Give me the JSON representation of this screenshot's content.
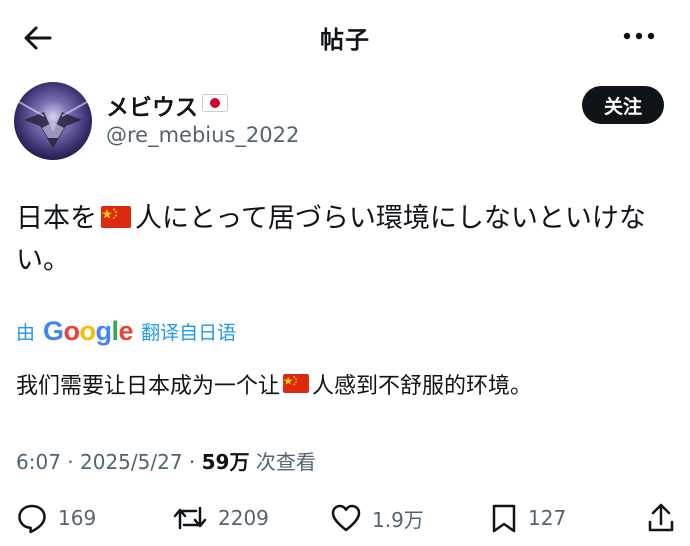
{
  "header": {
    "title": "帖子"
  },
  "author": {
    "name": "メビウス",
    "handle": "@re_mebius_2022",
    "follow_label": "关注"
  },
  "post": {
    "text_part1": "日本を",
    "text_part2": "人にとって居づらい環境にしないといけない。",
    "translate_prefix": "由",
    "translate_brand": "Google",
    "translate_suffix": "翻译自日语",
    "translated_part1": "我们需要让日本成为一个让",
    "translated_part2": "人感到不舒服的环境。"
  },
  "meta": {
    "time": "6:07",
    "sep1": " · ",
    "date": "2025/5/27",
    "sep2": " · ",
    "views": "59万",
    "views_label": " 次查看"
  },
  "actions": {
    "replies": "169",
    "reposts": "2209",
    "likes": "1.9万",
    "bookmarks": "127"
  },
  "icons": {
    "back": "arrow-left-icon",
    "more": "more-horizontal-icon",
    "reply": "reply-icon",
    "repost": "repost-icon",
    "like": "heart-icon",
    "bookmark": "bookmark-icon",
    "share": "share-icon"
  },
  "colors": {
    "link": "#1d9bf0",
    "muted": "#536471",
    "text": "#0f1419"
  }
}
